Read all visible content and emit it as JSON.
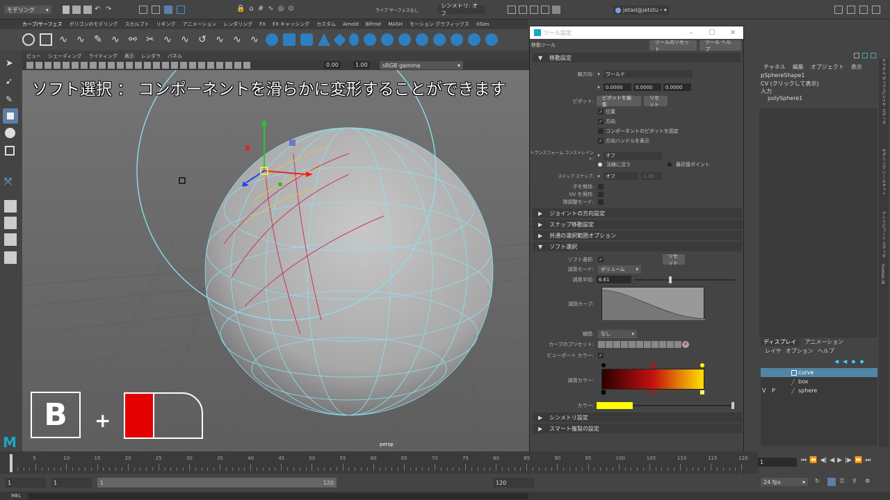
{
  "statusline": {
    "mode": "モデリング",
    "symmetry": "シンメトリ: オフ",
    "live": "ライブ サーフェスなし",
    "user": "jetad@jetstu・"
  },
  "shelf_tabs": [
    "カーブ/サーフェス",
    "ポリゴンのモデリング",
    "スカルプト",
    "リギング",
    "アニメーション",
    "レンダリング",
    "FX",
    "FX キャッシング",
    "カスタム",
    "Arnold",
    "Bifrost",
    "MASH",
    "モーション グラフィックス",
    "XGen"
  ],
  "panel_menu": [
    "ビュー",
    "シェーディング",
    "ライティング",
    "表示",
    "レンダラ",
    "パネル"
  ],
  "panel_toolbar": {
    "exposure": "0.00",
    "gamma": "1.00",
    "colorspace": "sRGB gamma"
  },
  "viewport": {
    "caption": "ソフト選択 ： コンポーネントを滑らかに変形することができます",
    "camera": "persp",
    "hotkey_letter": "B"
  },
  "tool_settings": {
    "window_title": "ツール設定",
    "tool_name": "移動ツール",
    "reset_tool": "ツールのリセット",
    "tool_help": "ツール ヘルプ",
    "sec_move": "移動設定",
    "axis_orient_label": "軸方向:",
    "axis_orient_value": "ワールド",
    "axis_values": [
      "0.0000",
      "0.0000",
      "0.0000"
    ],
    "pivot_label": "ピボット:",
    "pivot_edit": "ピボットを編集",
    "pivot_reset": "リセット",
    "pivot_checks": [
      {
        "label": "位置",
        "checked": true
      },
      {
        "label": "方向",
        "checked": true
      },
      {
        "label": "コンポーネントのピボットを固定",
        "checked": false
      },
      {
        "label": "方向ハンドルを表示",
        "checked": true
      }
    ],
    "transform_constraint_label": "トランスフォーム コンストレイント:",
    "transform_constraint_value": "オフ",
    "radio_along_normal": "法線に沿う",
    "radio_nearest_point": "最近接ポイント",
    "step_snap_label": "ステップ スナップ:",
    "step_snap_value": "オフ",
    "step_snap_num": "1.00",
    "preserve_children": "子を保持:",
    "preserve_uv": "UV を保持:",
    "tweak_mode": "微調整モード:",
    "sec_joint": "ジョイントの方向設定",
    "sec_snap": "スナップ移動設定",
    "sec_common": "共通の選択範囲オプション",
    "sec_soft": "ソフト選択",
    "soft_select_label": "ソフト選択:",
    "soft_reset": "リセット",
    "falloff_mode_label": "減衰モード:",
    "falloff_mode_value": "ボリューム",
    "falloff_radius_label": "減衰半径:",
    "falloff_radius_value": "6.61",
    "falloff_radius_fraction": 0.35,
    "falloff_curve_label": "減衰カーブ:",
    "interp_label": "補間:",
    "interp_value": "なし",
    "curve_presets_label": "カーブのプリセット:",
    "viewport_color_label": "ビューポート カラー:",
    "falloff_color_label": "減衰カラー:",
    "color_label": "カラー:",
    "color_value": "#ffff00",
    "sec_symmetry": "シンメトリ設定",
    "sec_smart": "スマート複製の設定"
  },
  "channel_box": {
    "menu": [
      "チャネル",
      "編集",
      "オブジェクト",
      "表示"
    ],
    "shape": "pSphereShape1",
    "cv_hint": "CV (クリックして表示)",
    "input": "入力",
    "input_node": "polySphere1",
    "side_tabs": [
      "チャネル ボックス/レイヤ エディタ",
      "モデリング ツールキット",
      "アトリビュート エディタ",
      "Human IK"
    ]
  },
  "layer_editor": {
    "tabs": [
      "ディスプレイ",
      "アニメーション"
    ],
    "menu": [
      "レイヤ",
      "オプション",
      "ヘルプ"
    ],
    "layers": [
      {
        "v": "",
        "p": "",
        "name": "curve",
        "selected": true
      },
      {
        "v": "",
        "p": "",
        "name": "box",
        "selected": false
      },
      {
        "v": "V",
        "p": "P",
        "name": "sphere",
        "selected": false
      }
    ]
  },
  "timeline": {
    "ticks": [
      "5",
      "10",
      "15",
      "20",
      "25",
      "30",
      "35",
      "40",
      "45",
      "50",
      "55",
      "60",
      "65",
      "70",
      "75",
      "80",
      "85",
      "90",
      "95",
      "100",
      "105",
      "110",
      "115",
      "120"
    ],
    "current_frame": "1",
    "range": {
      "start": "1",
      "inner_start": "1",
      "slider_start": "1",
      "slider_end": "120",
      "end": "120"
    },
    "fps": "24 fps"
  },
  "cmdline": {
    "label": "MEL"
  }
}
